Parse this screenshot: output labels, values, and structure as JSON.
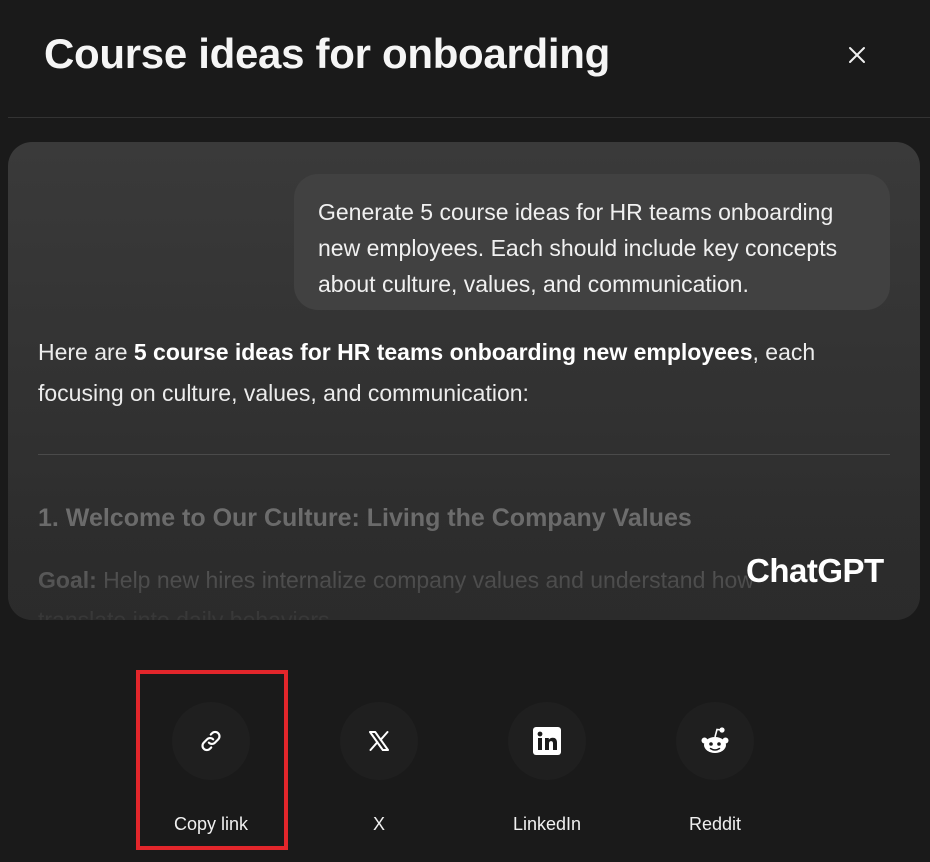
{
  "dialog": {
    "title": "Course ideas for onboarding",
    "close_icon": "close-icon"
  },
  "preview": {
    "user_message": "Generate 5 course ideas for HR teams onboarding new employees. Each should include key concepts about culture, values, and communication.",
    "assistant_intro_prefix": "Here are ",
    "assistant_intro_bold": "5 course ideas for HR teams onboarding new employees",
    "assistant_intro_suffix": ", each focusing on culture, values, and communication:",
    "section_heading": "1. Welcome to Our Culture: Living the Company Values",
    "goal_label": "Goal:",
    "goal_text": " Help new hires internalize company values and understand how they",
    "goal_text_continued": "translate into daily behaviors.",
    "brand": "ChatGPT"
  },
  "share_options": [
    {
      "label": "Copy link",
      "icon": "link-icon"
    },
    {
      "label": "X",
      "icon": "x-logo-icon"
    },
    {
      "label": "LinkedIn",
      "icon": "linkedin-icon"
    },
    {
      "label": "Reddit",
      "icon": "reddit-icon"
    }
  ],
  "colors": {
    "background": "#1a1a1a",
    "preview_card": "#333333",
    "user_bubble": "#414141",
    "highlight": "#e3262b"
  }
}
